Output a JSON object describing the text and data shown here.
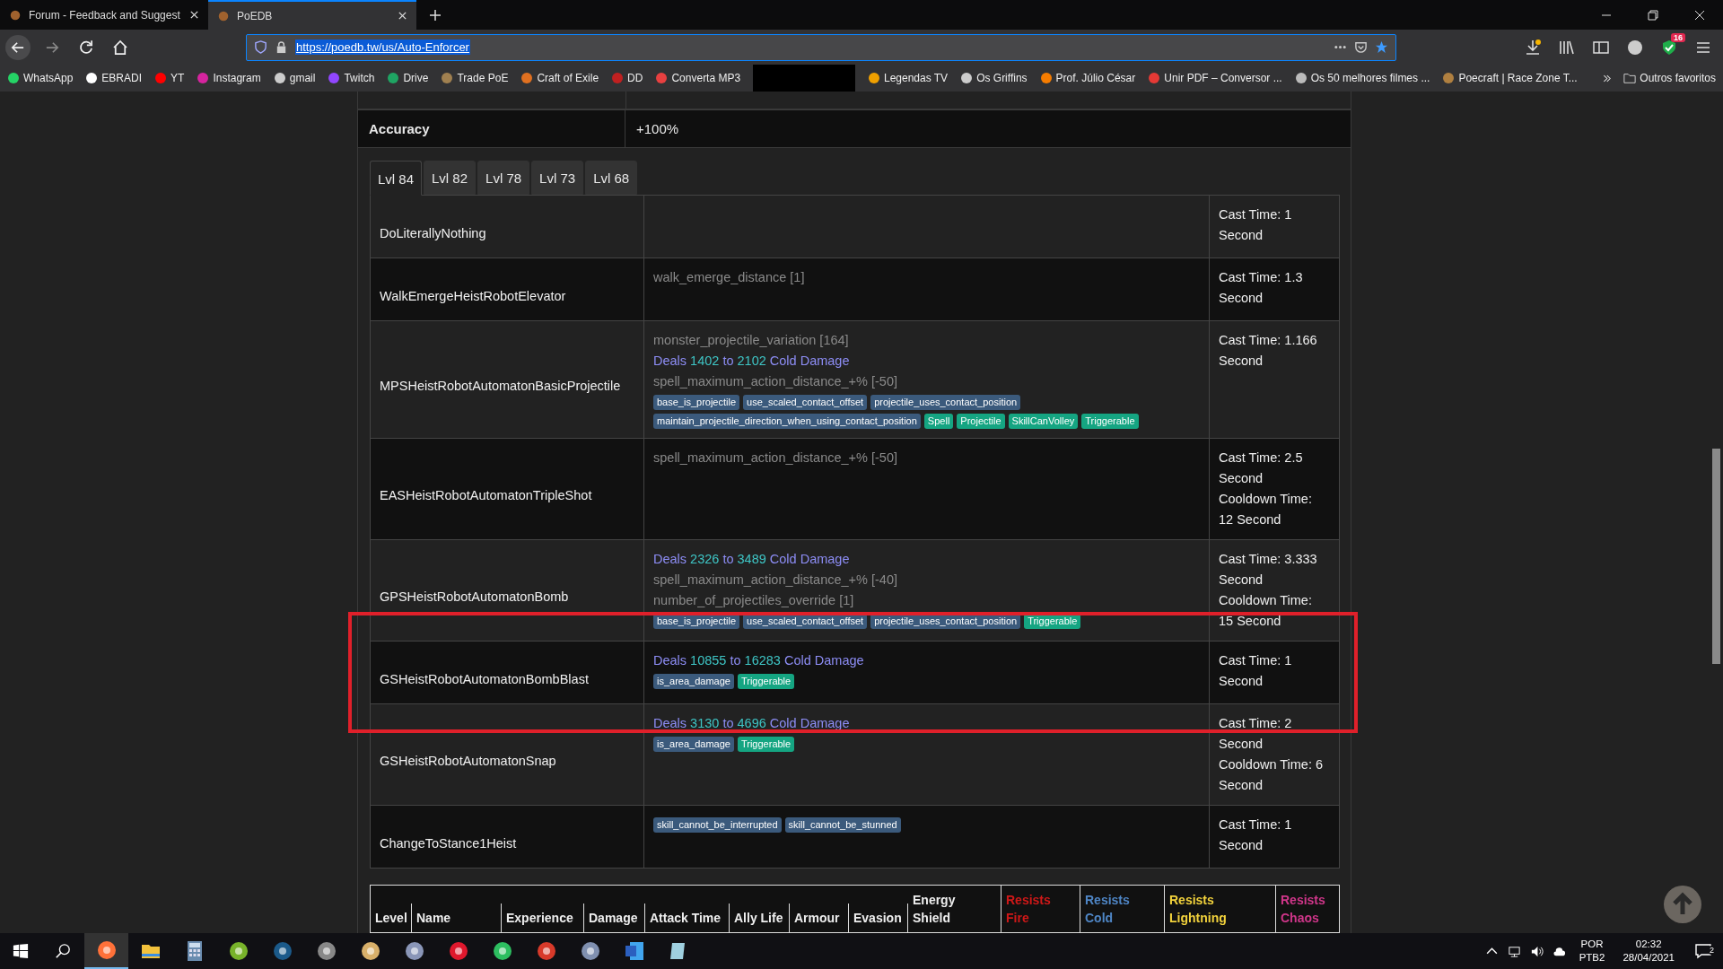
{
  "browser": {
    "tabs": [
      {
        "title": "Forum - Feedback and Suggest",
        "selected": false
      },
      {
        "title": "PoEDB",
        "selected": true
      }
    ],
    "url": "https://poedb.tw/us/Auto-Enforcer",
    "badge": "16",
    "bookmarks": [
      {
        "label": "WhatsApp",
        "color": "#25d366"
      },
      {
        "label": "EBRADI",
        "color": "#ffffff"
      },
      {
        "label": "YT",
        "color": "#ff0000"
      },
      {
        "label": "Instagram",
        "color": "#d6249f"
      },
      {
        "label": "gmail",
        "color": "#cccccc"
      },
      {
        "label": "Twitch",
        "color": "#9146ff"
      },
      {
        "label": "Drive",
        "color": "#1fa463"
      },
      {
        "label": "Trade PoE",
        "color": "#a08050"
      },
      {
        "label": "Craft of Exile",
        "color": "#e07020"
      },
      {
        "label": "DD",
        "color": "#c02020"
      },
      {
        "label": "Converta MP3",
        "color": "#e84040"
      }
    ],
    "bookmarks_right": [
      {
        "label": "Legendas TV",
        "color": "#f0a000"
      },
      {
        "label": "Os Griffins",
        "color": "#cccccc"
      },
      {
        "label": "Prof. Júlio César",
        "color": "#f57c00"
      },
      {
        "label": "Unir PDF – Conversor ...",
        "color": "#e53935"
      },
      {
        "label": "Os 50 melhores filmes ...",
        "color": "#bbbbbb"
      },
      {
        "label": "Poecraft | Race Zone T...",
        "color": "#b08040"
      }
    ],
    "other_bookmarks": "Outros favoritos"
  },
  "accuracy": {
    "label": "Accuracy",
    "value": "+100%"
  },
  "level_tabs": [
    {
      "label": "Lvl 84",
      "selected": true
    },
    {
      "label": "Lvl 82",
      "selected": false
    },
    {
      "label": "Lvl 78",
      "selected": false
    },
    {
      "label": "Lvl 73",
      "selected": false
    },
    {
      "label": "Lvl 68",
      "selected": false
    }
  ],
  "skills": [
    {
      "name": "DoLiterallyNothing",
      "times": [
        "Cast Time: 1 Second"
      ]
    },
    {
      "name": "WalkEmergeHeistRobotElevator",
      "lines": [
        {
          "kind": "stat",
          "text": "walk_emerge_distance [1]"
        }
      ],
      "times": [
        "Cast Time: 1.3 Second"
      ]
    },
    {
      "name": "MPSHeistRobotAutomatonBasicProjectile",
      "lines": [
        {
          "kind": "stat",
          "text": "monster_projectile_variation [164]"
        },
        {
          "kind": "deals",
          "pre": "Deals",
          "min": "1402",
          "mid": "to",
          "max": "2102",
          "post": "Cold Damage"
        },
        {
          "kind": "stat",
          "text": "spell_maximum_action_distance_+% [-50]"
        }
      ],
      "tags": [
        {
          "text": "base_is_projectile",
          "kind": "flag"
        },
        {
          "text": "use_scaled_contact_offset",
          "kind": "flag"
        },
        {
          "text": "projectile_uses_contact_position",
          "kind": "flag"
        },
        {
          "text": "maintain_projectile_direction_when_using_contact_position",
          "kind": "flag"
        },
        {
          "text": "Spell",
          "kind": "type"
        },
        {
          "text": "Projectile",
          "kind": "type"
        },
        {
          "text": "SkillCanVolley",
          "kind": "type"
        },
        {
          "text": "Triggerable",
          "kind": "type"
        }
      ],
      "times": [
        "Cast Time: 1.166 Second"
      ]
    },
    {
      "name": "EASHeistRobotAutomatonTripleShot",
      "lines": [
        {
          "kind": "stat",
          "text": "spell_maximum_action_distance_+% [-50]"
        }
      ],
      "times": [
        "Cast Time: 2.5 Second",
        "Cooldown Time: 12 Second"
      ]
    },
    {
      "name": "GPSHeistRobotAutomatonBomb",
      "lines": [
        {
          "kind": "deals",
          "pre": "Deals",
          "min": "2326",
          "mid": "to",
          "max": "3489",
          "post": "Cold Damage"
        },
        {
          "kind": "stat",
          "text": "spell_maximum_action_distance_+% [-40]"
        },
        {
          "kind": "stat",
          "text": "number_of_projectiles_override [1]"
        }
      ],
      "tags": [
        {
          "text": "base_is_projectile",
          "kind": "flag"
        },
        {
          "text": "use_scaled_contact_offset",
          "kind": "flag"
        },
        {
          "text": "projectile_uses_contact_position",
          "kind": "flag"
        },
        {
          "text": "Triggerable",
          "kind": "type"
        }
      ],
      "times": [
        "Cast Time: 3.333 Second",
        "Cooldown Time: 15 Second"
      ]
    },
    {
      "name": "GSHeistRobotAutomatonBombBlast",
      "lines": [
        {
          "kind": "deals",
          "pre": "Deals",
          "min": "10855",
          "mid": "to",
          "max": "16283",
          "post": "Cold Damage"
        }
      ],
      "tags": [
        {
          "text": "is_area_damage",
          "kind": "flag"
        },
        {
          "text": "Triggerable",
          "kind": "type"
        }
      ],
      "times": [
        "Cast Time: 1 Second"
      ]
    },
    {
      "name": "GSHeistRobotAutomatonSnap",
      "lines": [
        {
          "kind": "deals",
          "pre": "Deals",
          "min": "3130",
          "mid": "to",
          "max": "4696",
          "post": "Cold Damage"
        }
      ],
      "tags": [
        {
          "text": "is_area_damage",
          "kind": "flag"
        },
        {
          "text": "Triggerable",
          "kind": "type"
        }
      ],
      "times": [
        "Cast Time: 2 Second",
        "Cooldown Time: 6 Second"
      ]
    },
    {
      "name": "ChangeToStance1Heist",
      "tags": [
        {
          "text": "skill_cannot_be_interrupted",
          "kind": "flag"
        },
        {
          "text": "skill_cannot_be_stunned",
          "kind": "flag"
        }
      ],
      "times": [
        "Cast Time: 1 Second"
      ]
    }
  ],
  "stats_table": {
    "columns": [
      {
        "label": "Level"
      },
      {
        "label": "Name"
      },
      {
        "label": "Experience"
      },
      {
        "label": "Damage"
      },
      {
        "label": "Attack Time"
      },
      {
        "label": "Ally Life"
      },
      {
        "label": "Armour"
      },
      {
        "label": "Evasion"
      },
      {
        "label": "Energy Shield"
      },
      {
        "label": "Resists Fire",
        "color": "#d01818"
      },
      {
        "label": "Resists Cold",
        "color": "#4f86c6"
      },
      {
        "label": "Resists Lightning",
        "color": "#f2d23c"
      },
      {
        "label": "Resists Chaos",
        "color": "#d0368a"
      }
    ]
  },
  "taskbar": {
    "apps": [
      {
        "kind": "firefox",
        "selected": true
      },
      {
        "kind": "folder",
        "selected": false
      },
      {
        "kind": "calculator",
        "selected": false
      },
      {
        "kind": "torrent",
        "selected": false
      },
      {
        "kind": "steam",
        "selected": false
      },
      {
        "kind": "gauge",
        "selected": false
      },
      {
        "kind": "palette",
        "selected": false
      },
      {
        "kind": "star",
        "selected": false
      },
      {
        "kind": "molecule",
        "selected": false
      },
      {
        "kind": "evernote",
        "selected": false
      },
      {
        "kind": "cleaner",
        "selected": false
      },
      {
        "kind": "grid",
        "selected": false
      },
      {
        "kind": "word",
        "selected": false
      },
      {
        "kind": "notepad",
        "selected": false
      }
    ],
    "language": "POR",
    "layout": "PTB2",
    "time": "02:32",
    "date": "28/04/2021",
    "notifications": "2"
  }
}
